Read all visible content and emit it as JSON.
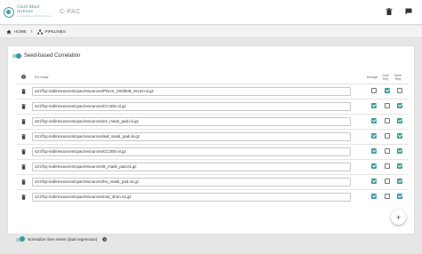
{
  "header": {
    "logo_line1": "Child Mind",
    "logo_line2": "Institute",
    "logo_sub": "transforming children's lives",
    "app_name": "C-PAC",
    "icons": [
      "trash-icon",
      "flag-icon"
    ]
  },
  "breadcrumb": {
    "home": "HOME",
    "pipelines": "PIPELINES"
  },
  "section": {
    "title": "Seed-based Correlation",
    "enabled": true
  },
  "table": {
    "col_roi": "Roi Image",
    "col_average": "Average",
    "col_dual_reg": "Dual Reg",
    "col_multi_reg": "Multi Reg",
    "rows": [
      {
        "path": "s3://fcp-indi/resources/cpac/resources/PNAS_Smith09_rsn10.nii.gz",
        "average": false,
        "dual_reg": true,
        "multi_reg": false
      },
      {
        "path": "s3://fcp-indi/resources/cpac/resources/CC400.nii.gz",
        "average": true,
        "dual_reg": false,
        "multi_reg": true
      },
      {
        "path": "s3://fcp-indi/resources/cpac/resources/ez_mask_pad.nii.gz",
        "average": true,
        "dual_reg": false,
        "multi_reg": true
      },
      {
        "path": "s3://fcp-indi/resources/cpac/resources/aal_mask_pad.nii.gz",
        "average": true,
        "dual_reg": false,
        "multi_reg": true
      },
      {
        "path": "s3://fcp-indi/resources/cpac/resources/CC200.nii.gz",
        "average": true,
        "dual_reg": false,
        "multi_reg": true
      },
      {
        "path": "s3://fcp-indi/resources/cpac/resources/tt_mask_pad.nii.gz",
        "average": true,
        "dual_reg": false,
        "multi_reg": true
      },
      {
        "path": "s3://fcp-indi/resources/cpac/resources/ho_mask_pad.nii.gz",
        "average": true,
        "dual_reg": false,
        "multi_reg": true
      },
      {
        "path": "s3://fcp-indi/resources/cpac/resources/rois_3mm.nii.gz",
        "average": true,
        "dual_reg": false,
        "multi_reg": true
      }
    ]
  },
  "add_button": "+",
  "footer": {
    "label": "Normalize time series (dual regression)",
    "enabled": true,
    "help": "?"
  },
  "colors": {
    "accent": "#3e999c",
    "accent_light": "#9ccbcd"
  }
}
